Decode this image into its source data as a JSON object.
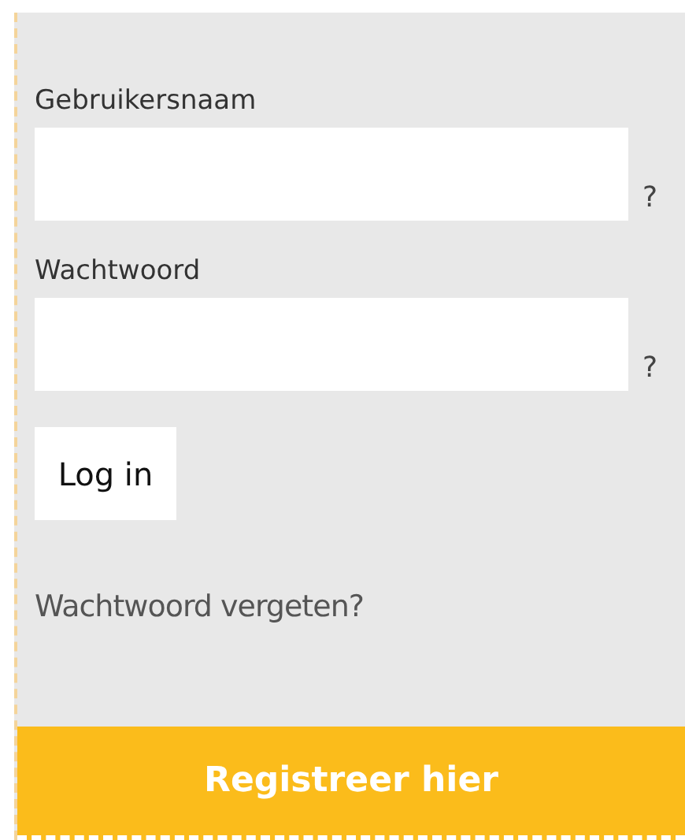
{
  "fields": [
    {
      "label": "Gebruikersnaam",
      "help": "?"
    },
    {
      "label": "Wachtwoord",
      "help": "?"
    }
  ],
  "login_button": "Log in",
  "forgot_link": "Wachtwoord vergeten?",
  "register_button": "Registreer hier"
}
